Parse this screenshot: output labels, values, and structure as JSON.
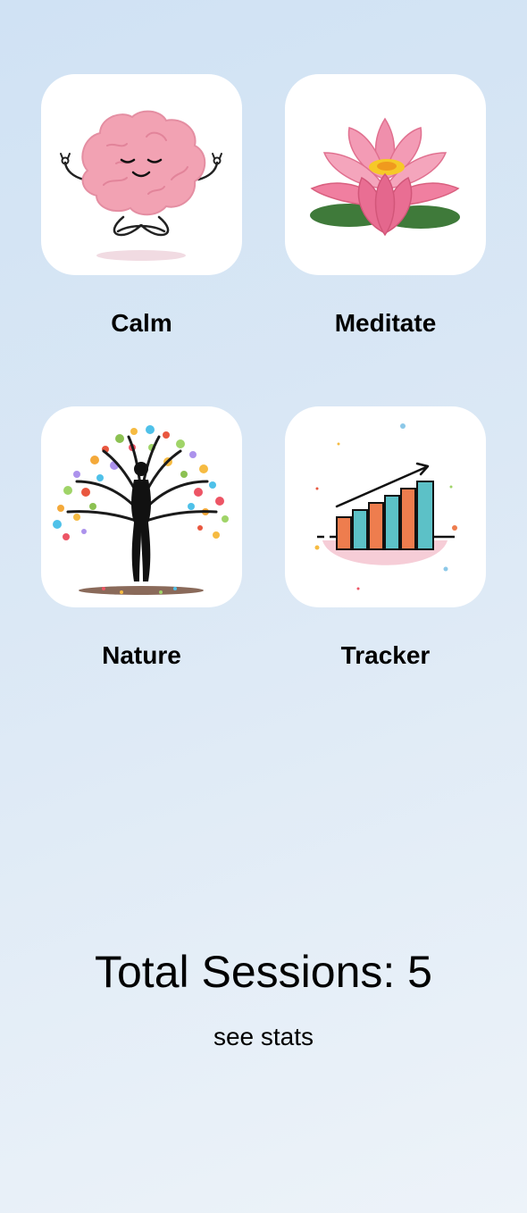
{
  "tiles": [
    {
      "label": "Calm",
      "icon": "meditating-brain-icon"
    },
    {
      "label": "Meditate",
      "icon": "lotus-flower-icon"
    },
    {
      "label": "Nature",
      "icon": "tree-figure-icon"
    },
    {
      "label": "Tracker",
      "icon": "progress-chart-icon"
    }
  ],
  "stats": {
    "sessions_text": "Total Sessions: 5",
    "total_sessions": 5,
    "link_label": "see stats"
  },
  "colors": {
    "background_start": "#d0e2f4",
    "background_end": "#edf3f9",
    "tile": "#ffffff",
    "text": "#000000"
  }
}
